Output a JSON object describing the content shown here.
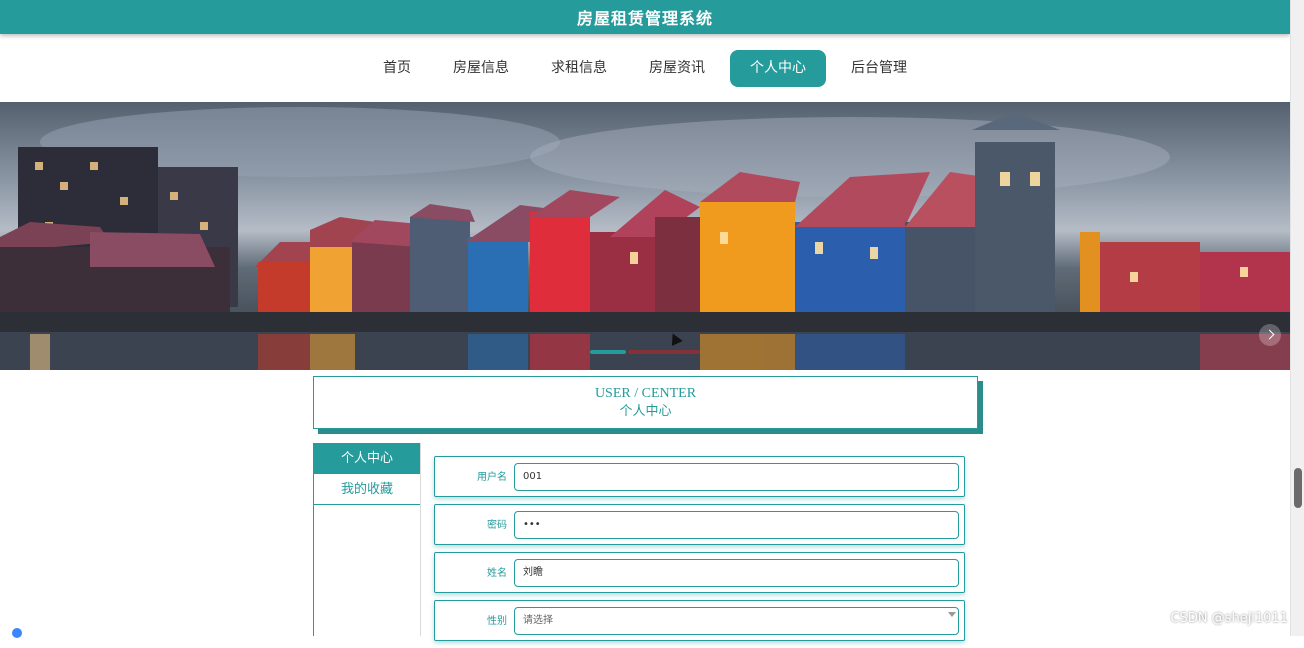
{
  "header": {
    "title": "房屋租赁管理系统"
  },
  "nav": {
    "items": [
      "首页",
      "房屋信息",
      "求租信息",
      "房屋资讯",
      "个人中心",
      "后台管理"
    ],
    "active_index": 4
  },
  "banner": {
    "image_name": "colorful-waterfront-houses"
  },
  "user_center": {
    "title_en": "USER / CENTER",
    "title_cn": "个人中心"
  },
  "sidebar": {
    "items": [
      "个人中心",
      "我的收藏"
    ],
    "active_index": 0
  },
  "form": {
    "fields": [
      {
        "label": "用户名",
        "value": "001"
      },
      {
        "label": "密码",
        "value": "•••"
      },
      {
        "label": "姓名",
        "value": "刘瞻"
      },
      {
        "label": "性别",
        "value": "请选择"
      }
    ]
  },
  "watermark": "CSDN @sheji1011",
  "colors": {
    "accent": "#259b9b"
  }
}
